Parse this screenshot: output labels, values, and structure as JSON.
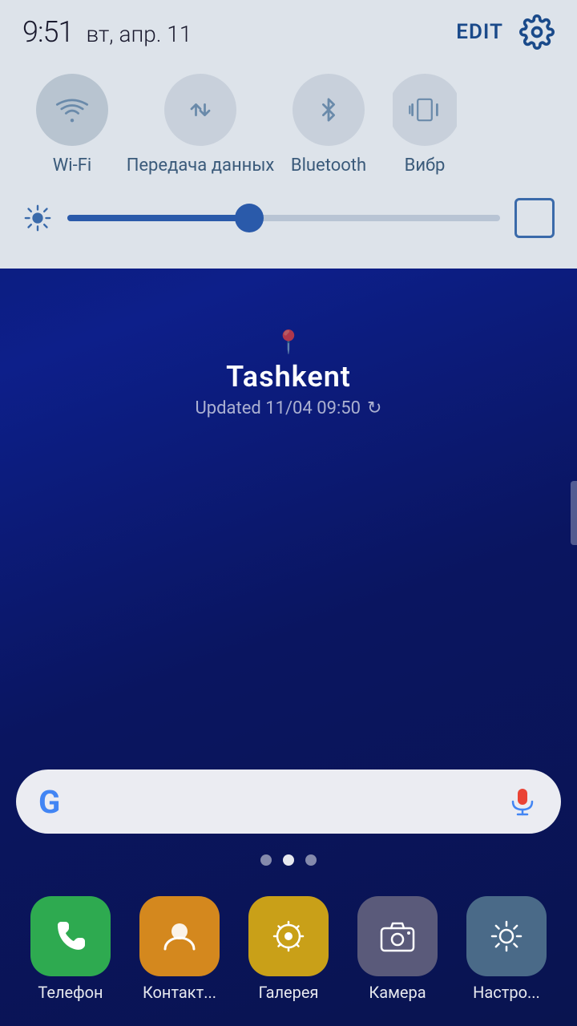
{
  "statusBar": {
    "time": "9:51",
    "date": "вт, апр. 11",
    "editLabel": "EDIT"
  },
  "quickToggles": [
    {
      "id": "wifi",
      "label": "Wi-Fi",
      "active": true
    },
    {
      "id": "data",
      "label": "Передача данных",
      "active": false
    },
    {
      "id": "bluetooth",
      "label": "Bluetooth",
      "active": false
    },
    {
      "id": "vibro",
      "label": "Вибр",
      "partial": true
    }
  ],
  "brightness": {
    "level": 42
  },
  "weather": {
    "city": "Tashkent",
    "updated": "Updated 11/04 09:50"
  },
  "search": {
    "placeholder": ""
  },
  "pageDots": [
    0,
    1,
    2
  ],
  "activeDot": 1,
  "dock": [
    {
      "id": "phone",
      "label": "Телефон"
    },
    {
      "id": "contacts",
      "label": "Контакт..."
    },
    {
      "id": "gallery",
      "label": "Галерея"
    },
    {
      "id": "camera",
      "label": "Камера"
    },
    {
      "id": "settings",
      "label": "Настро..."
    }
  ]
}
